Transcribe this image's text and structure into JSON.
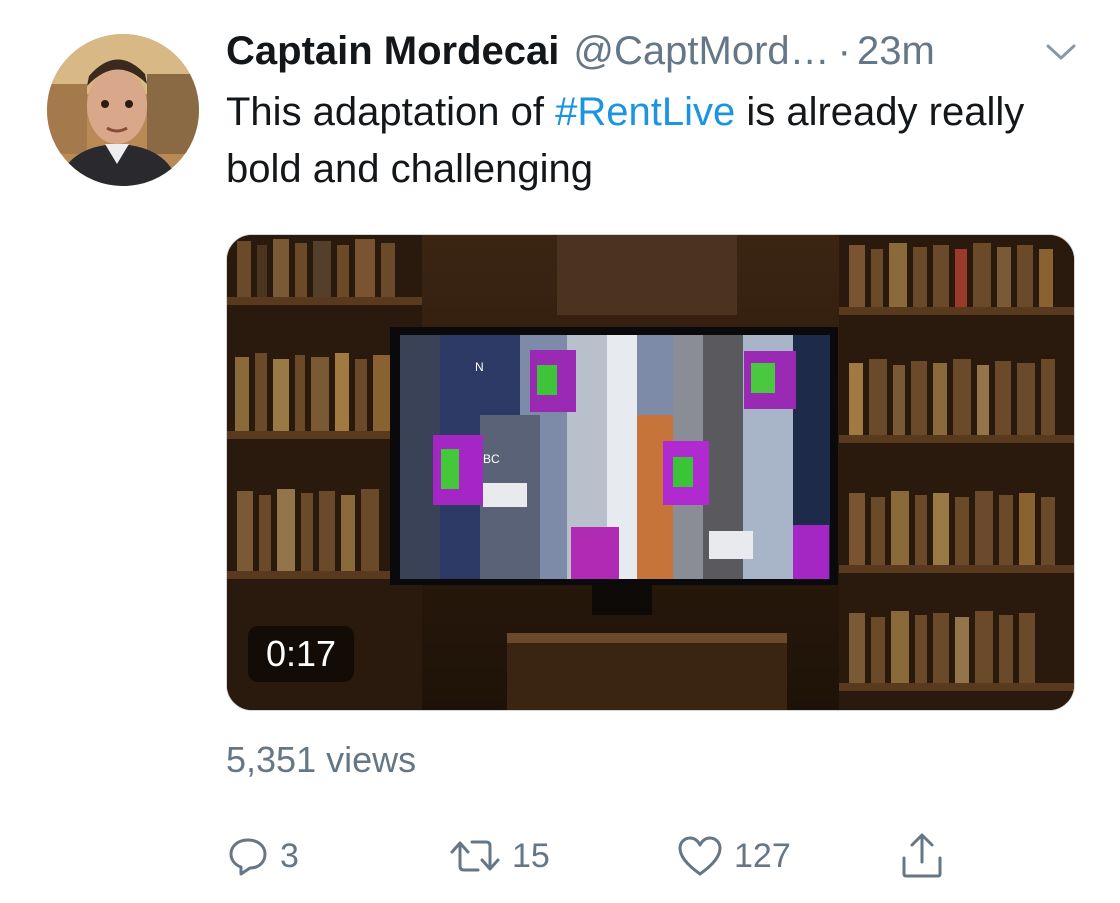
{
  "tweet": {
    "author": {
      "name": "Captain Mordecai",
      "handle": "@CaptMord…",
      "separator": "·",
      "time": "23m",
      "avatar_icon": "profile-photo"
    },
    "text": {
      "before": "This adaptation of ",
      "hashtag": "#RentLive",
      "after": " is already really bold and challenging"
    },
    "media": {
      "type": "video",
      "duration": "0:17",
      "tv_logo_text": "N",
      "tv_logo_text2": "BC"
    },
    "views": "5,351 views",
    "actions": {
      "reply": {
        "icon": "reply-icon",
        "count": "3"
      },
      "retweet": {
        "icon": "retweet-icon",
        "count": "15"
      },
      "like": {
        "icon": "heart-icon",
        "count": "127"
      },
      "share": {
        "icon": "share-icon"
      }
    }
  },
  "colors": {
    "text": "#14171a",
    "secondary": "#657786",
    "link": "#1b95e0"
  }
}
